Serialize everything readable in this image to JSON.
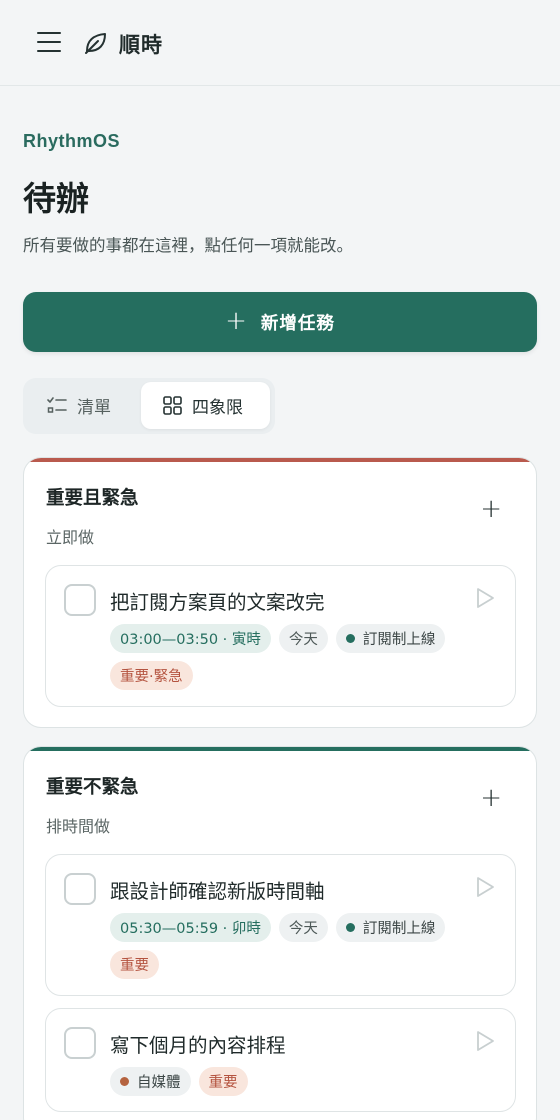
{
  "topbar": {
    "app_name": "順時",
    "menu_icon": "hamburger-menu-icon",
    "logo_icon": "leaf-icon"
  },
  "header": {
    "eyebrow": "RhythmOS",
    "title": "待辦",
    "subtitle": "所有要做的事都在這裡，點任何一項就能改。"
  },
  "add_task": {
    "label": "新增任務",
    "icon": "plus-icon"
  },
  "view_toggle": {
    "list_label": "清單",
    "quadrant_label": "四象限",
    "selected": "四象限"
  },
  "colors": {
    "accent": "#256e5f",
    "urgent": "#b95a4e",
    "tag_text": "#b4533f",
    "tag_bg": "#f9e6dd",
    "project_dot": "#256e5f",
    "media_dot": "#b5633f"
  },
  "quadrants": [
    {
      "title": "重要且緊急",
      "subtitle": "立即做",
      "add_label": "+",
      "tasks": [
        {
          "title": "把訂閱方案頁的文案改完",
          "time": "03:00—03:50 · 寅時",
          "day": "今天",
          "project": "訂閱制上線",
          "tag": "重要·緊急"
        }
      ]
    },
    {
      "title": "重要不緊急",
      "subtitle": "排時間做",
      "add_label": "+",
      "tasks": [
        {
          "title": "跟設計師確認新版時間軸",
          "time": "05:30—05:59 · 卯時",
          "day": "今天",
          "project": "訂閱制上線",
          "tag": "重要"
        },
        {
          "title": "寫下個月的內容排程",
          "project": "自媒體",
          "tag": "重要"
        }
      ]
    }
  ]
}
